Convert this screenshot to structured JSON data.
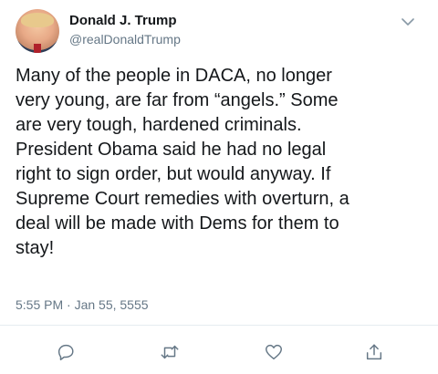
{
  "author": {
    "name": "Donald J. Trump",
    "handle": "@realDonaldTrump",
    "avatar_icon": "profile-photo"
  },
  "tweet": {
    "text": "Many of the people in DACA, no longer\nvery young, are far from “angels.” Some\nare very tough, hardened criminals.\nPresident Obama said he had no legal\nright to sign order, but would anyway. If\nSupreme Court remedies with overturn, a\ndeal will be made with Dems for them to\nstay!",
    "timestamp": "5:55 PM · Jan 55, 5555"
  },
  "actions": {
    "reply_icon": "reply-icon",
    "retweet_icon": "retweet-icon",
    "like_icon": "heart-icon",
    "share_icon": "share-icon"
  },
  "colors": {
    "text": "#14171a",
    "secondary": "#657786",
    "divider": "#e6ecf0"
  }
}
